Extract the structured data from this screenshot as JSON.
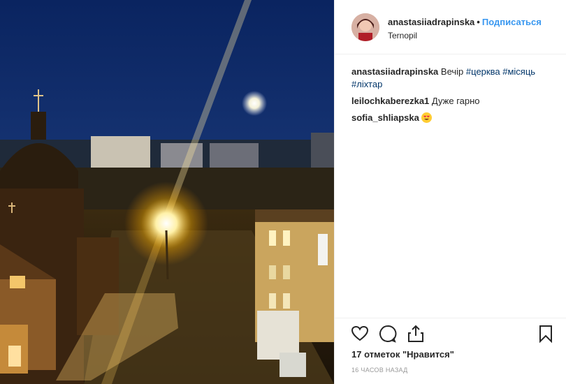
{
  "post": {
    "username": "anastasiiadrapinska",
    "separator": "•",
    "follow_label": "Подписаться",
    "location": "Ternopil"
  },
  "comments": [
    {
      "user": "anastasiiadrapinska",
      "text": "Вечір",
      "tags": [
        "#церква",
        "#місяць",
        "#ліхтар"
      ]
    },
    {
      "user": "leilochkaberezka1",
      "text": "Дуже гарно"
    },
    {
      "user": "sofia_shliapska",
      "emoji": "smiling-face-heart-eyes"
    }
  ],
  "likes_label": "17 отметок \"Нравится\"",
  "timestamp": "16 часов назад",
  "icons": [
    "heart-icon",
    "comment-icon",
    "share-icon",
    "bookmark-icon"
  ],
  "colors": {
    "link": "#3897f0",
    "hashtag": "#003569",
    "muted": "#999999"
  }
}
